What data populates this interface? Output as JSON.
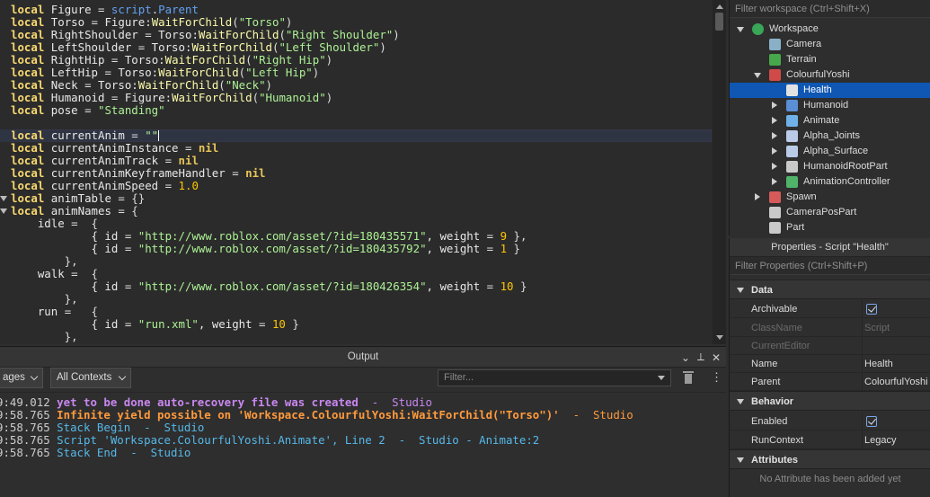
{
  "editor": {
    "lines": [
      {
        "tokens": [
          {
            "t": "local",
            "c": "kw"
          },
          {
            "t": " Figure ",
            "c": "id"
          },
          {
            "t": "=",
            "c": "op"
          },
          {
            "t": " script",
            "c": "mem"
          },
          {
            "t": ".",
            "c": "op"
          },
          {
            "t": "Parent",
            "c": "mem"
          }
        ]
      },
      {
        "tokens": [
          {
            "t": "local",
            "c": "kw"
          },
          {
            "t": " Torso ",
            "c": "id"
          },
          {
            "t": "=",
            "c": "op"
          },
          {
            "t": " Figure:",
            "c": "id"
          },
          {
            "t": "WaitForChild",
            "c": "fn"
          },
          {
            "t": "(",
            "c": "op"
          },
          {
            "t": "\"Torso\"",
            "c": "str"
          },
          {
            "t": ")",
            "c": "op"
          }
        ]
      },
      {
        "tokens": [
          {
            "t": "local",
            "c": "kw"
          },
          {
            "t": " RightShoulder ",
            "c": "id"
          },
          {
            "t": "=",
            "c": "op"
          },
          {
            "t": " Torso:",
            "c": "id"
          },
          {
            "t": "WaitForChild",
            "c": "fn"
          },
          {
            "t": "(",
            "c": "op"
          },
          {
            "t": "\"Right Shoulder\"",
            "c": "str"
          },
          {
            "t": ")",
            "c": "op"
          }
        ]
      },
      {
        "tokens": [
          {
            "t": "local",
            "c": "kw"
          },
          {
            "t": " LeftShoulder ",
            "c": "id"
          },
          {
            "t": "=",
            "c": "op"
          },
          {
            "t": " Torso:",
            "c": "id"
          },
          {
            "t": "WaitForChild",
            "c": "fn"
          },
          {
            "t": "(",
            "c": "op"
          },
          {
            "t": "\"Left Shoulder\"",
            "c": "str"
          },
          {
            "t": ")",
            "c": "op"
          }
        ]
      },
      {
        "tokens": [
          {
            "t": "local",
            "c": "kw"
          },
          {
            "t": " RightHip ",
            "c": "id"
          },
          {
            "t": "=",
            "c": "op"
          },
          {
            "t": " Torso:",
            "c": "id"
          },
          {
            "t": "WaitForChild",
            "c": "fn"
          },
          {
            "t": "(",
            "c": "op"
          },
          {
            "t": "\"Right Hip\"",
            "c": "str"
          },
          {
            "t": ")",
            "c": "op"
          }
        ]
      },
      {
        "tokens": [
          {
            "t": "local",
            "c": "kw"
          },
          {
            "t": " LeftHip ",
            "c": "id"
          },
          {
            "t": "=",
            "c": "op"
          },
          {
            "t": " Torso:",
            "c": "id"
          },
          {
            "t": "WaitForChild",
            "c": "fn"
          },
          {
            "t": "(",
            "c": "op"
          },
          {
            "t": "\"Left Hip\"",
            "c": "str"
          },
          {
            "t": ")",
            "c": "op"
          }
        ]
      },
      {
        "tokens": [
          {
            "t": "local",
            "c": "kw"
          },
          {
            "t": " Neck ",
            "c": "id"
          },
          {
            "t": "=",
            "c": "op"
          },
          {
            "t": " Torso:",
            "c": "id"
          },
          {
            "t": "WaitForChild",
            "c": "fn"
          },
          {
            "t": "(",
            "c": "op"
          },
          {
            "t": "\"Neck\"",
            "c": "str"
          },
          {
            "t": ")",
            "c": "op"
          }
        ]
      },
      {
        "tokens": [
          {
            "t": "local",
            "c": "kw"
          },
          {
            "t": " Humanoid ",
            "c": "id"
          },
          {
            "t": "=",
            "c": "op"
          },
          {
            "t": " Figure:",
            "c": "id"
          },
          {
            "t": "WaitForChild",
            "c": "fn"
          },
          {
            "t": "(",
            "c": "op"
          },
          {
            "t": "\"Humanoid\"",
            "c": "str"
          },
          {
            "t": ")",
            "c": "op"
          }
        ]
      },
      {
        "tokens": [
          {
            "t": "local",
            "c": "kw"
          },
          {
            "t": " pose ",
            "c": "id"
          },
          {
            "t": "=",
            "c": "op"
          },
          {
            "t": " \"Standing\"",
            "c": "str"
          }
        ]
      },
      {
        "tokens": []
      },
      {
        "current": true,
        "caret": true,
        "tokens": [
          {
            "t": "local",
            "c": "kw"
          },
          {
            "t": " currentAnim ",
            "c": "id"
          },
          {
            "t": "=",
            "c": "op"
          },
          {
            "t": " \"\"",
            "c": "str"
          }
        ]
      },
      {
        "tokens": [
          {
            "t": "local",
            "c": "kw"
          },
          {
            "t": " currentAnimInstance ",
            "c": "id"
          },
          {
            "t": "=",
            "c": "op"
          },
          {
            "t": " nil",
            "c": "kwn"
          }
        ]
      },
      {
        "tokens": [
          {
            "t": "local",
            "c": "kw"
          },
          {
            "t": " currentAnimTrack ",
            "c": "id"
          },
          {
            "t": "=",
            "c": "op"
          },
          {
            "t": " nil",
            "c": "kwn"
          }
        ]
      },
      {
        "tokens": [
          {
            "t": "local",
            "c": "kw"
          },
          {
            "t": " currentAnimKeyframeHandler ",
            "c": "id"
          },
          {
            "t": "=",
            "c": "op"
          },
          {
            "t": " nil",
            "c": "kwn"
          }
        ]
      },
      {
        "tokens": [
          {
            "t": "local",
            "c": "kw"
          },
          {
            "t": " currentAnimSpeed ",
            "c": "id"
          },
          {
            "t": "=",
            "c": "op"
          },
          {
            "t": " 1.0",
            "c": "num"
          }
        ]
      },
      {
        "fold": true,
        "tokens": [
          {
            "t": "local",
            "c": "kw"
          },
          {
            "t": " animTable ",
            "c": "id"
          },
          {
            "t": "=",
            "c": "op"
          },
          {
            "t": " {}",
            "c": "op"
          }
        ]
      },
      {
        "fold": true,
        "tokens": [
          {
            "t": "local",
            "c": "kw"
          },
          {
            "t": " animNames ",
            "c": "id"
          },
          {
            "t": "=",
            "c": "op"
          },
          {
            "t": " {",
            "c": "op"
          }
        ]
      },
      {
        "tokens": [
          {
            "t": "    idle ",
            "c": "id"
          },
          {
            "t": "=  {",
            "c": "op"
          }
        ]
      },
      {
        "tokens": [
          {
            "t": "            { id ",
            "c": "id"
          },
          {
            "t": "=",
            "c": "op"
          },
          {
            "t": " \"http://www.roblox.com/asset/?id=180435571\"",
            "c": "str"
          },
          {
            "t": ", weight ",
            "c": "id"
          },
          {
            "t": "=",
            "c": "op"
          },
          {
            "t": " 9",
            "c": "num"
          },
          {
            "t": " },",
            "c": "op"
          }
        ]
      },
      {
        "tokens": [
          {
            "t": "            { id ",
            "c": "id"
          },
          {
            "t": "=",
            "c": "op"
          },
          {
            "t": " \"http://www.roblox.com/asset/?id=180435792\"",
            "c": "str"
          },
          {
            "t": ", weight ",
            "c": "id"
          },
          {
            "t": "=",
            "c": "op"
          },
          {
            "t": " 1",
            "c": "num"
          },
          {
            "t": " }",
            "c": "op"
          }
        ]
      },
      {
        "tokens": [
          {
            "t": "        },",
            "c": "op"
          }
        ]
      },
      {
        "tokens": [
          {
            "t": "    walk ",
            "c": "id"
          },
          {
            "t": "=  {",
            "c": "op"
          }
        ]
      },
      {
        "tokens": [
          {
            "t": "            { id ",
            "c": "id"
          },
          {
            "t": "=",
            "c": "op"
          },
          {
            "t": " \"http://www.roblox.com/asset/?id=180426354\"",
            "c": "str"
          },
          {
            "t": ", weight ",
            "c": "id"
          },
          {
            "t": "=",
            "c": "op"
          },
          {
            "t": " 10",
            "c": "num"
          },
          {
            "t": " }",
            "c": "op"
          }
        ]
      },
      {
        "tokens": [
          {
            "t": "        },",
            "c": "op"
          }
        ]
      },
      {
        "tokens": [
          {
            "t": "    run ",
            "c": "id"
          },
          {
            "t": "=   {",
            "c": "op"
          }
        ]
      },
      {
        "tokens": [
          {
            "t": "            { id ",
            "c": "id"
          },
          {
            "t": "=",
            "c": "op"
          },
          {
            "t": " \"run.xml\"",
            "c": "str"
          },
          {
            "t": ", weight ",
            "c": "id"
          },
          {
            "t": "=",
            "c": "op"
          },
          {
            "t": " 10",
            "c": "num"
          },
          {
            "t": " }",
            "c": "op"
          }
        ]
      },
      {
        "tokens": [
          {
            "t": "        },",
            "c": "op"
          }
        ]
      }
    ]
  },
  "output": {
    "title": "Output",
    "messages_dropdown": "ages",
    "contexts_dropdown": "All Contexts",
    "filter_placeholder": "Filter...",
    "header_buttons": [
      "⌄",
      "⟂",
      "✕"
    ],
    "log": [
      {
        "ts": "9:49.012",
        "text": "yet to be done auto-recovery file was created",
        "suffix": "  -  Studio",
        "color": "#c987f0",
        "bold": true
      },
      {
        "ts": "9:58.765",
        "text": "Infinite yield possible on 'Workspace.ColourfulYoshi:WaitForChild(\"Torso\")'",
        "suffix": "  -  Studio",
        "color": "#ff9a3c",
        "bold": true
      },
      {
        "ts": "9:58.765",
        "text": "Stack Begin",
        "suffix": "  -  Studio",
        "color": "#56b8e8",
        "bold": false
      },
      {
        "ts": "9:58.765",
        "text": "Script 'Workspace.ColourfulYoshi.Animate', Line 2",
        "suffix": "  -  Studio - Animate:2",
        "color": "#56b8e8",
        "bold": false
      },
      {
        "ts": "9:58.765",
        "text": "Stack End",
        "suffix": "  -  Studio",
        "color": "#56b8e8",
        "bold": false
      }
    ]
  },
  "explorer": {
    "filter_placeholder": "Filter workspace (Ctrl+Shift+X)",
    "items": [
      {
        "label": "Workspace",
        "depth": 0,
        "expand": "down",
        "icon": "globe-icon",
        "color": "#3aa657",
        "selected": false
      },
      {
        "label": "Camera",
        "depth": 1,
        "expand": "none",
        "icon": "camera-icon",
        "color": "#8ab0c8",
        "selected": false
      },
      {
        "label": "Terrain",
        "depth": 1,
        "expand": "none",
        "icon": "terrain-icon",
        "color": "#46a84a",
        "selected": false
      },
      {
        "label": "ColourfulYoshi",
        "depth": 1,
        "expand": "down",
        "icon": "model-icon",
        "color": "#d04a4a",
        "selected": false
      },
      {
        "label": "Health",
        "depth": 2,
        "expand": "none",
        "icon": "script-icon",
        "color": "#e2e2e2",
        "selected": true
      },
      {
        "label": "Humanoid",
        "depth": 2,
        "expand": "right",
        "icon": "humanoid-icon",
        "color": "#5a8fd6",
        "selected": false
      },
      {
        "label": "Animate",
        "depth": 2,
        "expand": "right",
        "icon": "localscript-icon",
        "color": "#6fb0e8",
        "selected": false
      },
      {
        "label": "Alpha_Joints",
        "depth": 2,
        "expand": "right",
        "icon": "mesh-icon",
        "color": "#b9cbe6",
        "selected": false
      },
      {
        "label": "Alpha_Surface",
        "depth": 2,
        "expand": "right",
        "icon": "mesh-icon",
        "color": "#b9cbe6",
        "selected": false
      },
      {
        "label": "HumanoidRootPart",
        "depth": 2,
        "expand": "right",
        "icon": "part-icon",
        "color": "#c9c9c9",
        "selected": false
      },
      {
        "label": "AnimationController",
        "depth": 2,
        "expand": "right",
        "icon": "animation-controller-icon",
        "color": "#4fb36a",
        "selected": false
      },
      {
        "label": "Spawn",
        "depth": 1,
        "expand": "right",
        "icon": "spawn-icon",
        "color": "#d65a5a",
        "selected": false
      },
      {
        "label": "CameraPosPart",
        "depth": 1,
        "expand": "none",
        "icon": "part-icon",
        "color": "#c9c9c9",
        "selected": false
      },
      {
        "label": "Part",
        "depth": 1,
        "expand": "none",
        "icon": "part-icon",
        "color": "#c9c9c9",
        "selected": false
      }
    ]
  },
  "properties": {
    "title": "Properties - Script \"Health\"",
    "filter_placeholder": "Filter Properties (Ctrl+Shift+P)",
    "data_section": "Data",
    "behavior_section": "Behavior",
    "attributes_section": "Attributes",
    "archivable_label": "Archivable",
    "classname_label": "ClassName",
    "classname_value": "Script",
    "currenteditor_label": "CurrentEditor",
    "name_label": "Name",
    "name_value": "Health",
    "parent_label": "Parent",
    "parent_value": "ColourfulYoshi",
    "enabled_label": "Enabled",
    "runcontext_label": "RunContext",
    "runcontext_value": "Legacy",
    "no_attributes": "No Attribute has been added yet"
  }
}
